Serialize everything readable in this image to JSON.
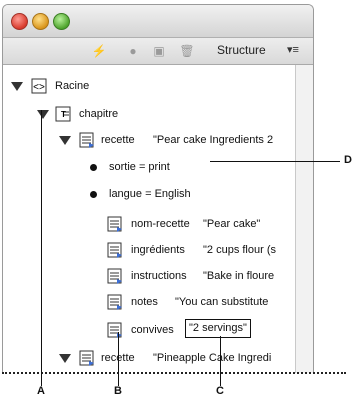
{
  "toolbar": {
    "title": "Structure",
    "menu": "▾≡"
  },
  "tree": {
    "root": {
      "label": "Racine"
    },
    "chapitre": {
      "label": "chapitre"
    },
    "recette1": {
      "label": "recette",
      "value": "\"Pear cake Ingredients 2"
    },
    "sortie": {
      "label": "sortie = print"
    },
    "langue": {
      "label": "langue = English"
    },
    "nomrecette": {
      "label": "nom-recette",
      "value": "\"Pear cake\""
    },
    "ingredients": {
      "label": "ingrédients",
      "value": "\"2 cups flour (s"
    },
    "instructions": {
      "label": "instructions",
      "value": "\"Bake in floure"
    },
    "notes": {
      "label": "notes",
      "value": "\"You can substitute"
    },
    "convives": {
      "label": "convives",
      "value": "\"2 servings\""
    },
    "recette2": {
      "label": "recette",
      "value": "\"Pineapple Cake Ingredi"
    }
  },
  "callouts": {
    "A": "A",
    "B": "B",
    "C": "C",
    "D": "D"
  }
}
